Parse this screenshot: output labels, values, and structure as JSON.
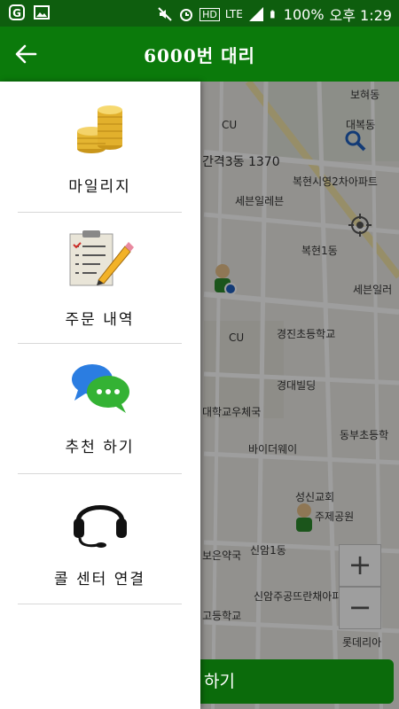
{
  "status_bar": {
    "icons_left": [
      "app-notification-icon",
      "image-icon"
    ],
    "network": "LTE",
    "battery": "100%",
    "time": "오후 1:29"
  },
  "app_bar": {
    "title": "6000번 대리",
    "back_icon": "arrow-left-icon"
  },
  "drawer": {
    "items": [
      {
        "label": "마일리지",
        "icon": "coins-icon"
      },
      {
        "label": "주문 내역",
        "icon": "clipboard-icon"
      },
      {
        "label": "추천 하기",
        "icon": "chat-bubbles-icon"
      },
      {
        "label": "콜 센터 연결",
        "icon": "headset-icon"
      }
    ]
  },
  "map": {
    "labels": {
      "l1": "보혀동",
      "l2": "CU",
      "l3": "간격3동 1370",
      "l4": "복현시영2차아파트",
      "l5": "세븐일레븐",
      "l6": "복현1동",
      "l7": "세븐일러",
      "l8": "CU",
      "l9": "경진초등학교",
      "l10": "경대빌딩",
      "l11": "대학교우체국",
      "l12": "동부초등학",
      "l13": "바이더웨이",
      "l14": "성신교회",
      "l15": "주제공원",
      "l16": "신암1동",
      "l17": "보은약국",
      "l18": "신암주공뜨란채아파트",
      "l19": "고등학교",
      "l20": "롯데리아",
      "l21": "대복동"
    },
    "zoom_in": "+",
    "zoom_out": "−"
  },
  "bottom_action": {
    "label": "하기"
  }
}
